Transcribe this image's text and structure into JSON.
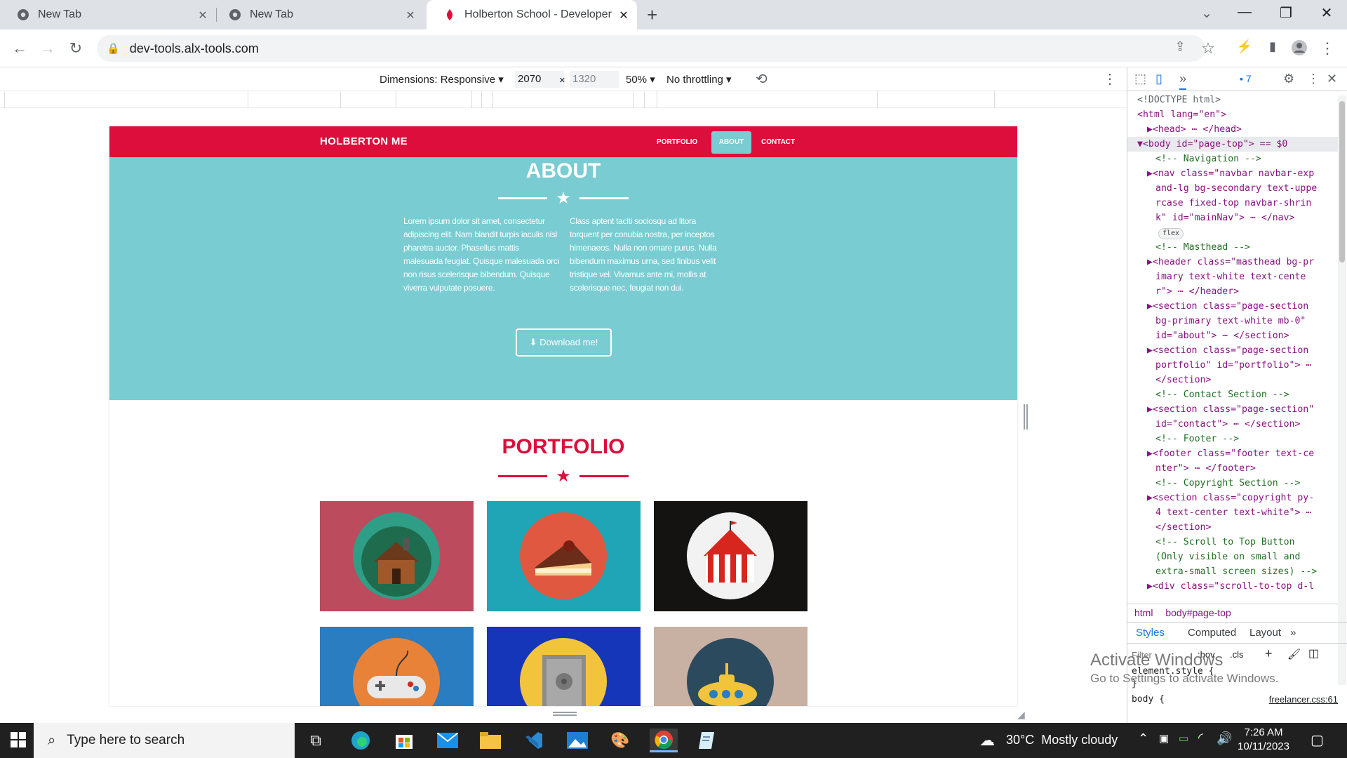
{
  "browser": {
    "tabs": [
      {
        "title": "New Tab",
        "close": "✕"
      },
      {
        "title": "New Tab",
        "close": "✕"
      },
      {
        "title": "Holberton School - Developer to",
        "close": "✕"
      }
    ],
    "new_tab": "+",
    "window": {
      "chevron": "⌄",
      "minimize": "—",
      "restore": "❐",
      "close": "✕"
    },
    "url": "dev-tools.alx-tools.com"
  },
  "device_toolbar": {
    "dimensions_label": "Dimensions: Responsive ▾",
    "width": "2070",
    "times": "×",
    "height": "1320",
    "zoom": "50% ▾",
    "throttling": "No throttling ▾"
  },
  "site": {
    "brand": "HOLBERTON ME",
    "nav": [
      {
        "label": "PORTFOLIO",
        "active": false
      },
      {
        "label": "ABOUT",
        "active": true
      },
      {
        "label": "CONTACT",
        "active": false
      }
    ],
    "about": {
      "title": "ABOUT",
      "col1": "Lorem ipsum dolor sit amet, consectetur adipiscing elit. Nam blandit turpis iaculis nisl pharetra auctor. Phasellus mattis malesuada feugiat. Quisque malesuada orci non risus scelerisque bibendum. Quisque viverra vulputate posuere.",
      "col2": "Class aptent taciti sociosqu ad litora torquent per conubia nostra, per inceptos himenaeos. Nulla non ornare purus. Nulla bibendum maximus urna, sed finibus velit tristique vel. Vivamus ante mi, mollis at scelerisque nec, feugiat non dui.",
      "download": "Download me!"
    },
    "portfolio": {
      "title": "PORTFOLIO",
      "items": [
        {
          "icon": "cabin-icon",
          "bg": "#bc4b5e",
          "circle": "#2f9e86"
        },
        {
          "icon": "cake-icon",
          "bg": "#1fa5b5",
          "circle": "#e05840"
        },
        {
          "icon": "circus-tent-icon",
          "bg": "#151212",
          "circle": "#f2f2f2"
        },
        {
          "icon": "game-controller-icon",
          "bg": "#2a7dc0",
          "circle": "#e98239"
        },
        {
          "icon": "safe-icon",
          "bg": "#1536b8",
          "circle": "#f1c43c"
        },
        {
          "icon": "submarine-icon",
          "bg": "#c8b0a3",
          "circle": "#2c4a5e"
        }
      ]
    }
  },
  "devtools": {
    "issues_count": "7",
    "dom": [
      {
        "t": "doc",
        "text": "<!DOCTYPE html>"
      },
      {
        "t": "open",
        "text": "<html lang=\"en\">"
      },
      {
        "t": "line",
        "text": "▶<head> ⋯ </head>"
      },
      {
        "t": "sel",
        "text": "▼<body id=\"page-top\"> == $0"
      },
      {
        "t": "cmt",
        "text": "<!-- Navigation -->"
      },
      {
        "t": "line",
        "text": "▶<nav class=\"navbar navbar-exp"
      },
      {
        "t": "line",
        "text": "and-lg bg-secondary text-uppe"
      },
      {
        "t": "line",
        "text": "rcase fixed-top navbar-shrin"
      },
      {
        "t": "line",
        "text": "k\" id=\"mainNav\"> ⋯ </nav>"
      },
      {
        "t": "badge",
        "text": "flex"
      },
      {
        "t": "cmt",
        "text": "<!-- Masthead -->"
      },
      {
        "t": "line",
        "text": "▶<header class=\"masthead bg-pr"
      },
      {
        "t": "line",
        "text": "imary text-white text-cente"
      },
      {
        "t": "line",
        "text": "r\"> ⋯ </header>"
      },
      {
        "t": "line",
        "text": "▶<section class=\"page-section"
      },
      {
        "t": "line",
        "text": "bg-primary text-white mb-0\""
      },
      {
        "t": "line",
        "text": "id=\"about\"> ⋯ </section>"
      },
      {
        "t": "line",
        "text": "▶<section class=\"page-section"
      },
      {
        "t": "line",
        "text": "portfolio\" id=\"portfolio\"> ⋯"
      },
      {
        "t": "line",
        "text": "</section>"
      },
      {
        "t": "cmt",
        "text": "<!-- Contact Section -->"
      },
      {
        "t": "line",
        "text": "▶<section class=\"page-section\""
      },
      {
        "t": "line",
        "text": "id=\"contact\"> ⋯ </section>"
      },
      {
        "t": "cmt",
        "text": "<!-- Footer -->"
      },
      {
        "t": "line",
        "text": "▶<footer class=\"footer text-ce"
      },
      {
        "t": "line",
        "text": "nter\"> ⋯ </footer>"
      },
      {
        "t": "cmt",
        "text": "<!-- Copyright Section -->"
      },
      {
        "t": "line",
        "text": "▶<section class=\"copyright py-"
      },
      {
        "t": "line",
        "text": "4 text-center text-white\"> ⋯"
      },
      {
        "t": "line",
        "text": "</section>"
      },
      {
        "t": "cmt",
        "text": "<!-- Scroll to Top Button"
      },
      {
        "t": "cmt",
        "text": "(Only visible on small and"
      },
      {
        "t": "cmt",
        "text": "extra-small screen sizes) -->"
      },
      {
        "t": "line",
        "text": "▶<div class=\"scroll-to-top d-l"
      }
    ],
    "breadcrumbs": [
      "html",
      "body#page-top"
    ],
    "style_tabs": [
      "Styles",
      "Computed",
      "Layout",
      "»"
    ],
    "filter_placeholder": "Filter",
    "hov": ":hov",
    "cls": ".cls",
    "element_style": "element.style {",
    "element_style_close": "}",
    "body_rule": "body {",
    "body_source": "freelancer.css:61"
  },
  "watermark": {
    "title": "Activate Windows",
    "subtitle": "Go to Settings to activate Windows."
  },
  "taskbar": {
    "search_placeholder": "Type here to search",
    "weather": "30°C  Mostly cloudy",
    "time": "7:26 AM",
    "date": "10/11/2023"
  }
}
